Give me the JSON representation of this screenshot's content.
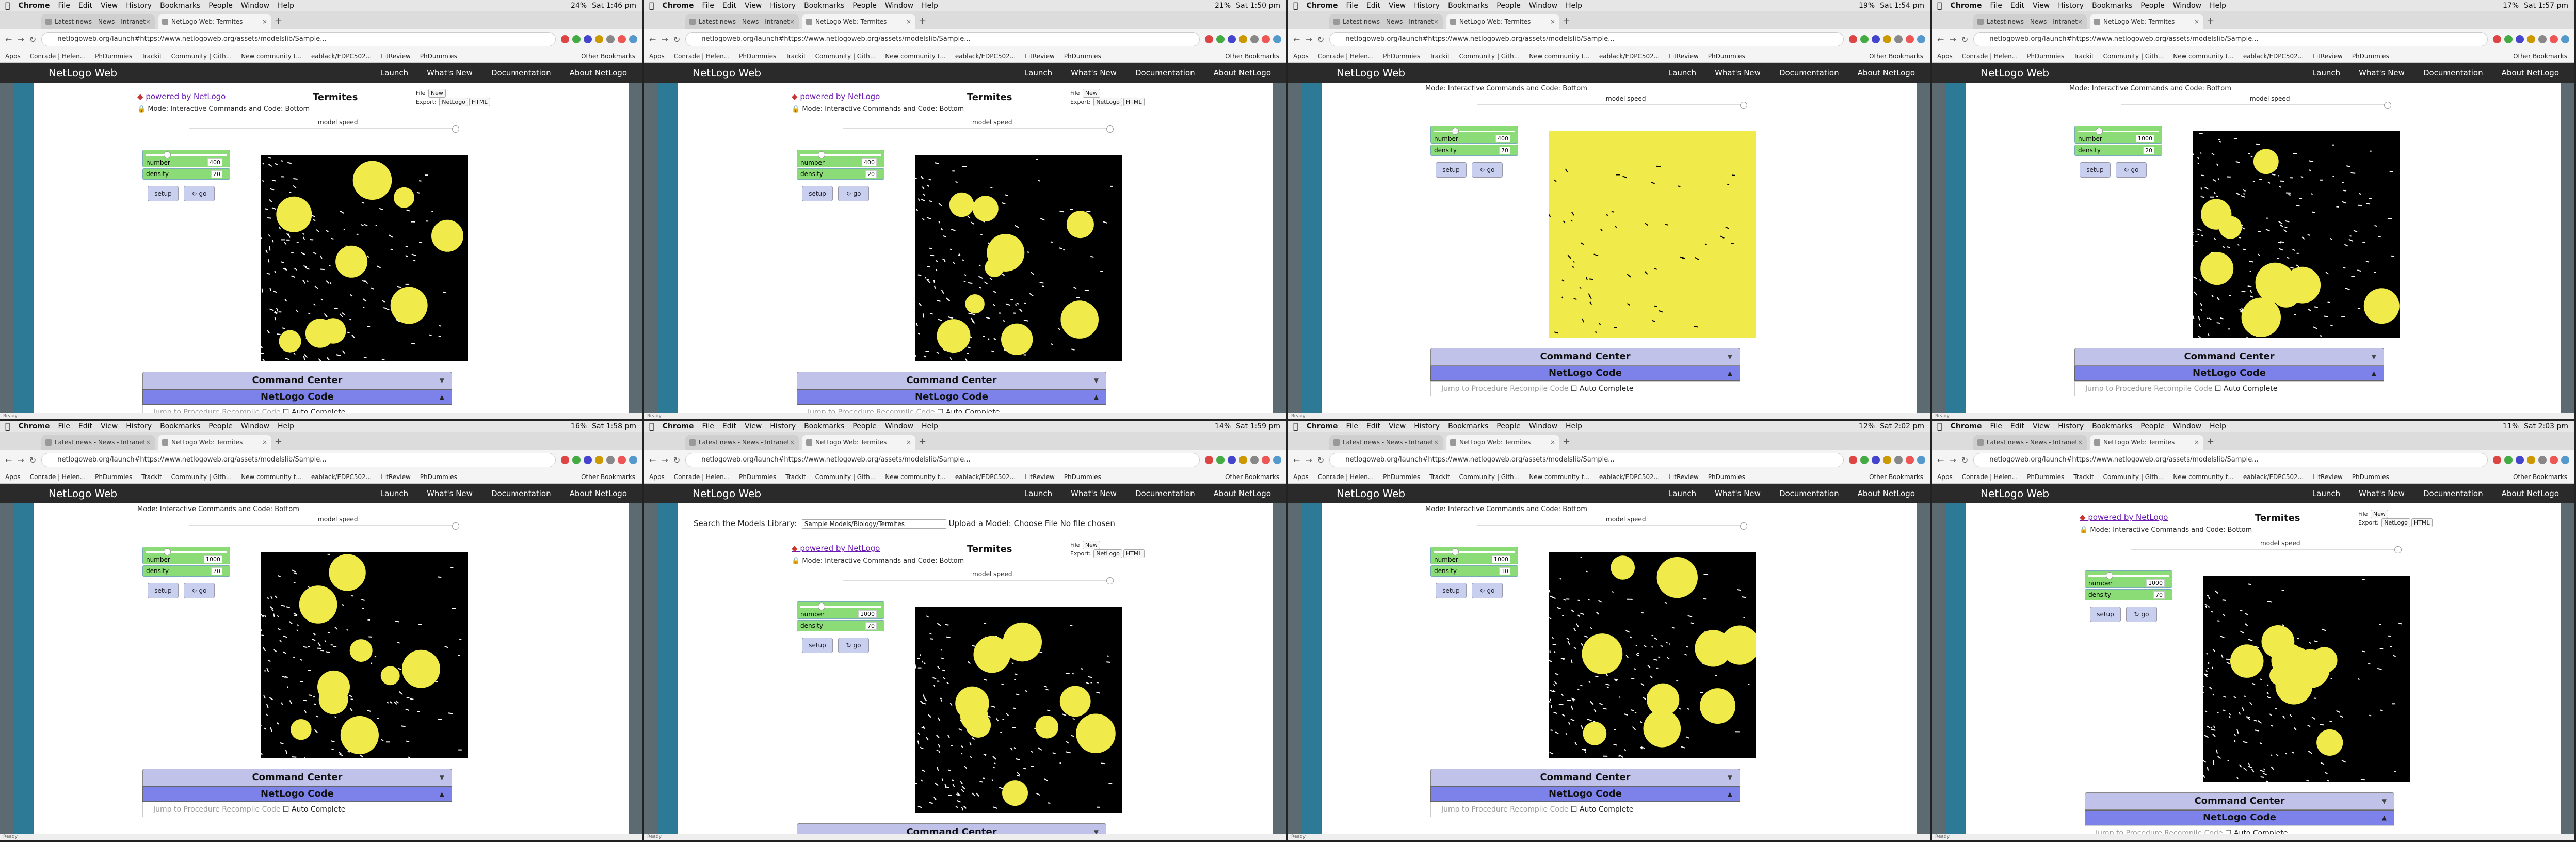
{
  "menubar": {
    "app": "Chrome",
    "items": [
      "File",
      "Edit",
      "View",
      "History",
      "Bookmarks",
      "People",
      "Window",
      "Help"
    ]
  },
  "tabs": [
    "Latest news - News - Intranet",
    "NetLogo Web: Termites"
  ],
  "url": "netlogoweb.org/launch#https://www.netlogoweb.org/assets/modelslib/Sample...",
  "bookmarks": [
    "Apps",
    "Conrade | Helen...",
    "PhDummies",
    "Trackit",
    "Community | Gith...",
    "New community t...",
    "eablack/EDPC502...",
    "LitReview",
    "PhDummies"
  ],
  "other_bookmarks": "Other Bookmarks",
  "site": {
    "title": "NetLogo Web",
    "nav": [
      "Launch",
      "What's New",
      "Documentation",
      "About NetLogo"
    ]
  },
  "model": {
    "powered": "powered by NetLogo",
    "title": "Termites",
    "mode": "Mode: Interactive",
    "cc_code": "Commands and Code: Bottom",
    "file": "File",
    "new": "New",
    "export": "Export:",
    "netlogo": "NetLogo",
    "html": "HTML",
    "speed": "model speed",
    "number_label": "number",
    "density_label": "density",
    "setup": "setup",
    "go": "go",
    "command_center": "Command Center",
    "netlogo_code": "NetLogo Code",
    "jump": "Jump to Procedure",
    "recompile": "Recompile Code",
    "autocomplete": "Auto Complete"
  },
  "library": {
    "search": "Search the Models Library:",
    "selected": "Sample Models/Biology/Termites",
    "upload": "Upload a Model:",
    "choose": "Choose File",
    "nofile": "No file chosen"
  },
  "status": "Ready",
  "panes": [
    {
      "time": "Sat 1:46 pm",
      "battery": "24%",
      "number": "400",
      "density": "20",
      "layout": "a"
    },
    {
      "time": "Sat 1:50 pm",
      "battery": "21%",
      "number": "400",
      "density": "20",
      "layout": "b"
    },
    {
      "time": "Sat 1:54 pm",
      "battery": "19%",
      "number": "400",
      "density": "70",
      "layout": "c"
    },
    {
      "time": "Sat 1:57 pm",
      "battery": "17%",
      "number": "1000",
      "density": "20",
      "layout": "d"
    },
    {
      "time": "Sat 1:58 pm",
      "battery": "16%",
      "number": "1000",
      "density": "70",
      "layout": "d"
    },
    {
      "time": "Sat 1:59 pm",
      "battery": "14%",
      "number": "1000",
      "density": "70",
      "layout": "e"
    },
    {
      "time": "Sat 2:02 pm",
      "battery": "12%",
      "number": "1000",
      "density": "10",
      "layout": "c"
    },
    {
      "time": "Sat 2:03 pm",
      "battery": "11%",
      "number": "1000",
      "density": "70",
      "layout": "b"
    }
  ],
  "colors": {
    "yellow": "#f0ea4a",
    "dark": "#000000",
    "white": "#ffffff",
    "slider": "#8bdc76",
    "button": "#c9cfee",
    "command": "#c1c2ea",
    "code": "#7c82ea",
    "accent": "#2d7a97"
  }
}
